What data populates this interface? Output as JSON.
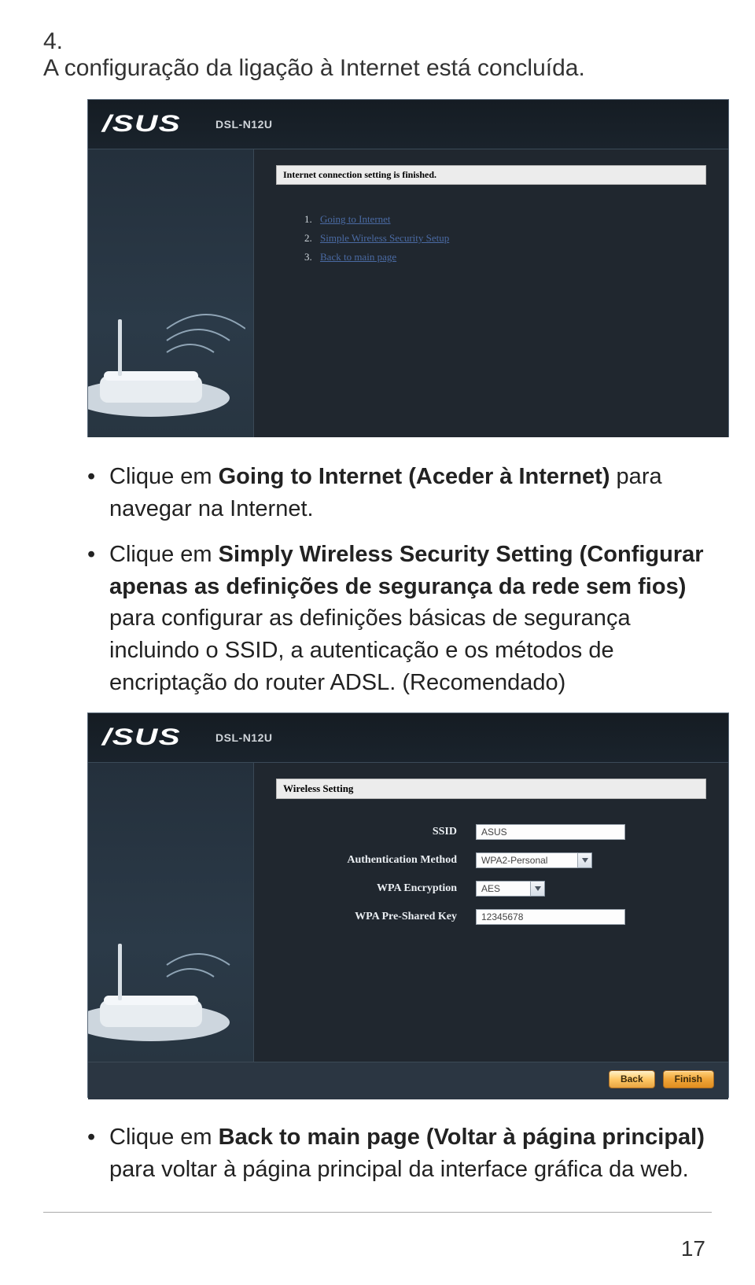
{
  "step": {
    "num": "4.",
    "text": "A configuração da ligação à Internet está concluída."
  },
  "window1": {
    "brand": "/SUS",
    "model": "DSL-N12U",
    "status": "Internet connection setting is finished.",
    "links": [
      {
        "idx": "1.",
        "label": "Going to Internet"
      },
      {
        "idx": "2.",
        "label": "Simple Wireless Security Setup"
      },
      {
        "idx": "3.",
        "label": "Back to main page"
      }
    ]
  },
  "bullet1": {
    "pre": "Clique em ",
    "bold": "Going to Internet (Aceder à Internet)",
    "post": " para navegar na Internet."
  },
  "bullet2": {
    "pre": "Clique em ",
    "bold": "Simply Wireless Security Setting (Configurar apenas as definições de segurança da rede sem fios)",
    "post": " para configurar as definições básicas de segurança incluindo o SSID, a autenticação e os métodos de encriptação do router ADSL. (Recomendado)"
  },
  "window2": {
    "brand": "/SUS",
    "model": "DSL-N12U",
    "panel_title": "Wireless Setting",
    "fields": {
      "ssid_label": "SSID",
      "ssid_value": "ASUS",
      "auth_label": "Authentication Method",
      "auth_value": "WPA2-Personal",
      "enc_label": "WPA Encryption",
      "enc_value": "AES",
      "key_label": "WPA Pre-Shared Key",
      "key_value": "12345678"
    },
    "buttons": {
      "back": "Back",
      "finish": "Finish"
    }
  },
  "bullet3": {
    "pre": "Clique em ",
    "bold": "Back to main page (Voltar à página principal)",
    "post": " para voltar à página principal da interface gráfica da web."
  },
  "page_number": "17"
}
